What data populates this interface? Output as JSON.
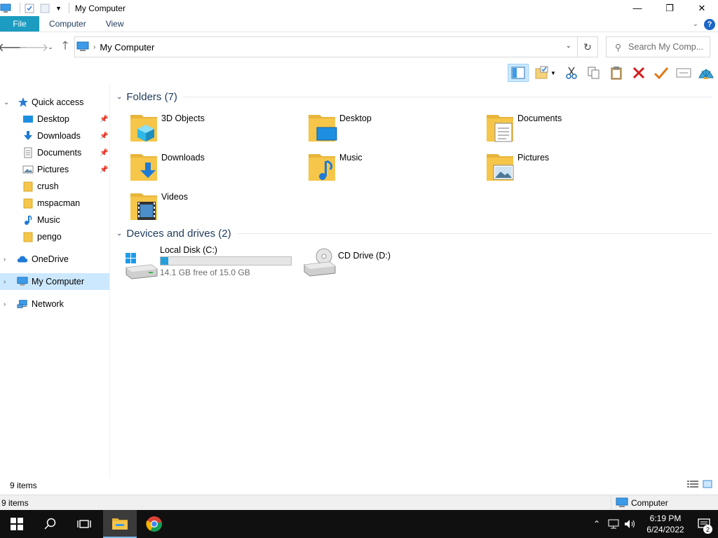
{
  "window": {
    "title": "My Computer",
    "minimize_glyph": "—",
    "maximize_glyph": "❐",
    "close_glyph": "✕"
  },
  "ribbon": {
    "tabs": [
      "File",
      "Computer",
      "View"
    ],
    "help": "?"
  },
  "address": {
    "path": "My Computer",
    "search_placeholder": "Search My Comp..."
  },
  "nav": {
    "quick_access": "Quick access",
    "items": [
      {
        "label": "Desktop",
        "icon": "desktop-icon",
        "pinned": true
      },
      {
        "label": "Downloads",
        "icon": "downloads-icon",
        "pinned": true
      },
      {
        "label": "Documents",
        "icon": "documents-icon",
        "pinned": true
      },
      {
        "label": "Pictures",
        "icon": "pictures-icon",
        "pinned": true
      },
      {
        "label": "crush",
        "icon": "folder-icon",
        "pinned": false
      },
      {
        "label": "mspacman",
        "icon": "folder-icon",
        "pinned": false
      },
      {
        "label": "Music",
        "icon": "music-icon",
        "pinned": false
      },
      {
        "label": "pengo",
        "icon": "folder-icon",
        "pinned": false
      }
    ],
    "onedrive": "OneDrive",
    "my_computer": "My Computer",
    "network": "Network"
  },
  "content": {
    "folders_header": "Folders (7)",
    "folders": [
      "3D Objects",
      "Desktop",
      "Documents",
      "Downloads",
      "Music",
      "Pictures",
      "Videos"
    ],
    "drives_header": "Devices and drives (2)",
    "drives": [
      {
        "name": "Local Disk (C:)",
        "free": "14.1 GB free of 15.0 GB",
        "used_fraction": 0.06
      },
      {
        "name": "CD Drive (D:)"
      }
    ]
  },
  "status": {
    "items_count": "9 items",
    "items_count_bottom": "9 items",
    "zone": "Computer"
  },
  "taskbar": {
    "time": "6:19 PM",
    "date": "6/24/2022",
    "notifications": "2"
  },
  "colors": {
    "accent": "#1c9cc0",
    "selection": "#cce8ff",
    "folder": "#f5c64a",
    "drive_bar": "#26a0da"
  }
}
